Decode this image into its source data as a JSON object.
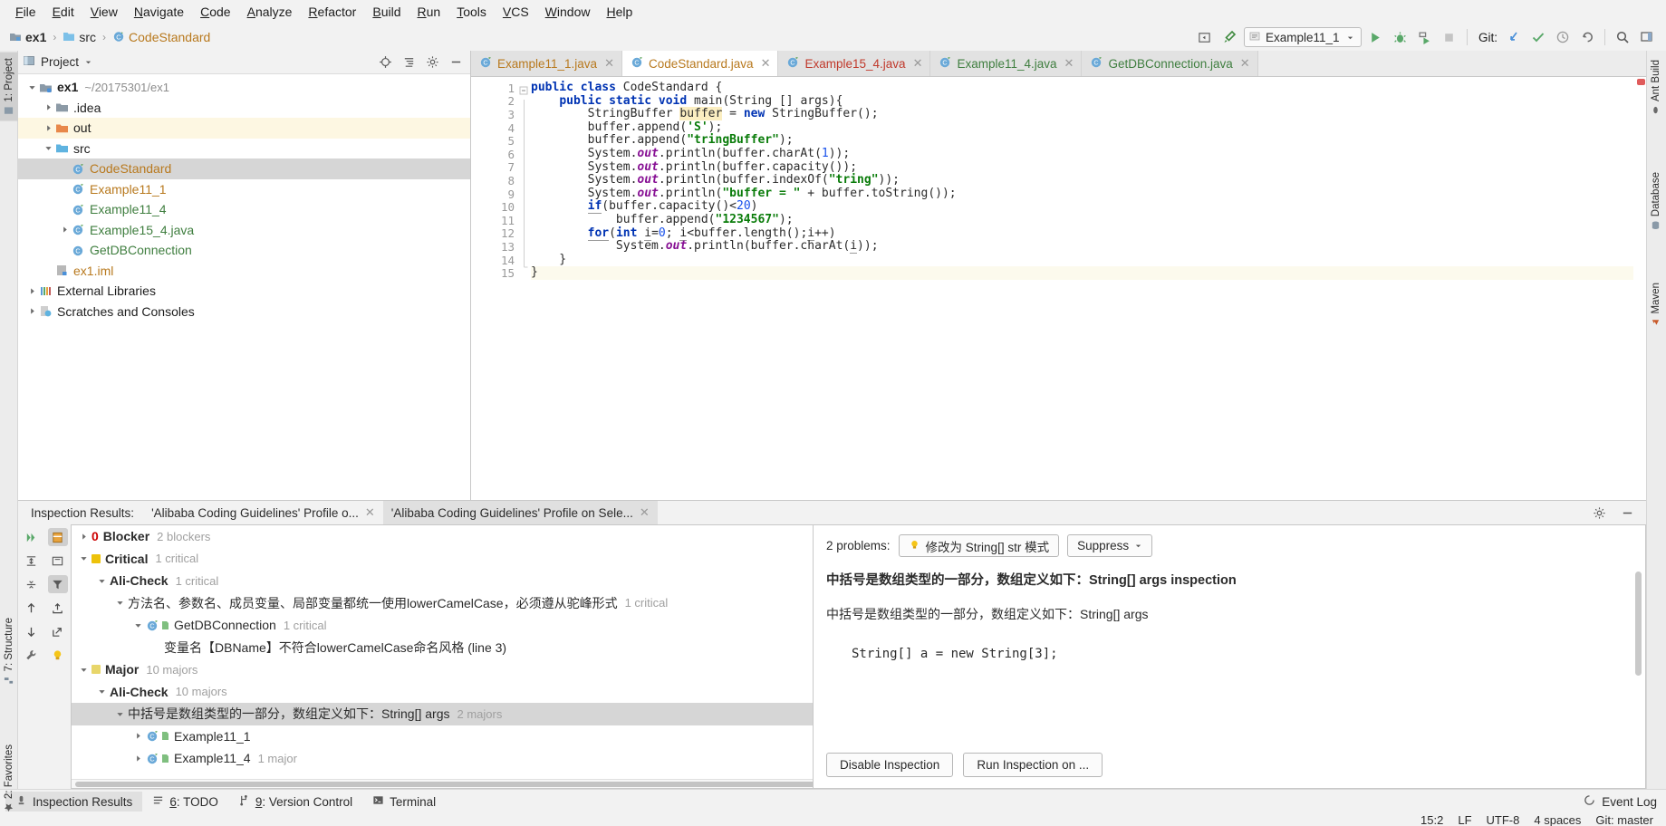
{
  "menubar": {
    "items": [
      "File",
      "Edit",
      "View",
      "Navigate",
      "Code",
      "Analyze",
      "Refactor",
      "Build",
      "Run",
      "Tools",
      "VCS",
      "Window",
      "Help"
    ]
  },
  "navbar": {
    "breadcrumbs": [
      {
        "label": "ex1",
        "icon": "module-icon"
      },
      {
        "label": "src",
        "icon": "folder-icon"
      },
      {
        "label": "CodeStandard",
        "icon": "java-class-icon"
      }
    ],
    "run_config": "Example11_1",
    "git_label": "Git:",
    "icons": [
      "settings-icon",
      "wrench-icon",
      "run-icon",
      "debug-icon",
      "run-coverage-icon",
      "stop-icon",
      "git-update-icon",
      "git-commit-icon",
      "git-history-icon",
      "git-rollback-icon",
      "search-icon",
      "layout-icon"
    ]
  },
  "left_strip": {
    "tabs": [
      {
        "label": "1: Project",
        "selected": true
      },
      {
        "label": "7: Structure",
        "selected": false
      },
      {
        "label": "2: Favorites",
        "selected": false
      }
    ]
  },
  "right_strip": {
    "tabs": [
      "Ant Build",
      "Database",
      "Maven"
    ]
  },
  "project_tree": {
    "title": "Project",
    "header_icons": [
      "locate-icon",
      "collapse-all-icon",
      "settings-icon",
      "hide-icon"
    ],
    "nodes": [
      {
        "label": "ex1",
        "sub": "~/20175301/ex1",
        "indent": 0,
        "arrow": "down",
        "icon": "module-icon",
        "bold": true,
        "color": "dark"
      },
      {
        "label": ".idea",
        "sub": "",
        "indent": 1,
        "arrow": "right",
        "icon": "folder-icon",
        "bold": false,
        "color": "dark"
      },
      {
        "label": "out",
        "sub": "",
        "indent": 1,
        "arrow": "right",
        "icon": "folder-excluded-icon",
        "bold": false,
        "color": "dark",
        "highlight": true
      },
      {
        "label": "src",
        "sub": "",
        "indent": 1,
        "arrow": "down",
        "icon": "source-folder-icon",
        "bold": false,
        "color": "dark"
      },
      {
        "label": "CodeStandard",
        "sub": "",
        "indent": 2,
        "arrow": "none",
        "icon": "java-class-icon",
        "bold": false,
        "color": "orange",
        "selected": true
      },
      {
        "label": "Example11_1",
        "sub": "",
        "indent": 2,
        "arrow": "none",
        "icon": "java-class-icon",
        "bold": false,
        "color": "orange"
      },
      {
        "label": "Example11_4",
        "sub": "",
        "indent": 2,
        "arrow": "none",
        "icon": "java-class-icon",
        "bold": false,
        "color": "green"
      },
      {
        "label": "Example15_4.java",
        "sub": "",
        "indent": 2,
        "arrow": "right",
        "icon": "java-class-icon",
        "bold": false,
        "color": "green"
      },
      {
        "label": "GetDBConnection",
        "sub": "",
        "indent": 2,
        "arrow": "none",
        "icon": "java-class-plain-icon",
        "bold": false,
        "color": "green"
      },
      {
        "label": "ex1.iml",
        "sub": "",
        "indent": 1,
        "arrow": "none",
        "icon": "iml-file-icon",
        "bold": false,
        "color": "orange"
      },
      {
        "label": "External Libraries",
        "sub": "",
        "indent": 0,
        "arrow": "right",
        "icon": "libraries-icon",
        "bold": false,
        "color": "dark"
      },
      {
        "label": "Scratches and Consoles",
        "sub": "",
        "indent": 0,
        "arrow": "right",
        "icon": "scratches-icon",
        "bold": false,
        "color": "dark"
      }
    ]
  },
  "editor": {
    "tabs": [
      {
        "label": "Example11_1.java",
        "color": "orange",
        "active": false
      },
      {
        "label": "CodeStandard.java",
        "color": "orange",
        "active": true
      },
      {
        "label": "Example15_4.java",
        "color": "red",
        "active": false
      },
      {
        "label": "Example11_4.java",
        "color": "green",
        "active": false
      },
      {
        "label": "GetDBConnection.java",
        "color": "green",
        "active": false
      }
    ],
    "line_numbers": [
      "1",
      "2",
      "3",
      "4",
      "5",
      "6",
      "7",
      "8",
      "9",
      "10",
      "11",
      "12",
      "13",
      "14",
      "15"
    ],
    "caret_line": 15,
    "code_lines": [
      "public class CodeStandard {",
      "    public static void main(String [] args){",
      "        StringBuffer buffer = new StringBuffer();",
      "        buffer.append('S');",
      "        buffer.append(\"tringBuffer\");",
      "        System.out.println(buffer.charAt(1));",
      "        System.out.println(buffer.capacity());",
      "        System.out.println(buffer.indexOf(\"tring\"));",
      "        System.out.println(\"buffer = \" + buffer.toString());",
      "        if(buffer.capacity()<20)",
      "            buffer.append(\"1234567\");",
      "        for(int i=0; i<buffer.length();i++)",
      "            System.out.println(buffer.charAt(i));",
      "    }",
      "}"
    ]
  },
  "inspection_panel": {
    "title": "Inspection Results:",
    "tabs": [
      {
        "label": "'Alibaba Coding Guidelines' Profile o...",
        "active": false
      },
      {
        "label": "'Alibaba Coding Guidelines' Profile on Sele...",
        "active": true
      }
    ],
    "header_icons": [
      "settings-icon",
      "hide-icon"
    ],
    "toolbar_left": [
      "rerun-icon",
      "expand-all-icon",
      "collapse-all-icon",
      "prev-icon",
      "next-icon",
      "settings-wrench-icon"
    ],
    "toolbar_right": [
      "group-by-severity-icon",
      "group-by-directory-icon",
      "filter-icon",
      "export-icon",
      "open-icon",
      "quickfix-bulb-icon"
    ],
    "tree": [
      {
        "label": "Blocker",
        "count": "2 blockers",
        "indent": 0,
        "arrow": "right",
        "badge": "blocker",
        "bold": true
      },
      {
        "label": "Critical",
        "count": "1 critical",
        "indent": 0,
        "arrow": "down",
        "badge": "critical",
        "bold": true
      },
      {
        "label": "Ali-Check",
        "count": "1 critical",
        "indent": 1,
        "arrow": "down",
        "badge": "none",
        "bold": true
      },
      {
        "label": "方法名、参数名、成员变量、局部变量都统一使用lowerCamelCase，必须遵从驼峰形式",
        "count": "1 critical",
        "indent": 2,
        "arrow": "down",
        "badge": "none",
        "bold": false
      },
      {
        "label": "GetDBConnection",
        "count": "1 critical",
        "indent": 3,
        "arrow": "down",
        "badge": "class",
        "bold": false
      },
      {
        "label": "变量名【DBName】不符合lowerCamelCase命名风格 (line 3)",
        "count": "",
        "indent": 4,
        "arrow": "none",
        "badge": "none",
        "bold": false
      },
      {
        "label": "Major",
        "count": "10 majors",
        "indent": 0,
        "arrow": "down",
        "badge": "major",
        "bold": true
      },
      {
        "label": "Ali-Check",
        "count": "10 majors",
        "indent": 1,
        "arrow": "down",
        "badge": "none",
        "bold": true
      },
      {
        "label": "中括号是数组类型的一部分，数组定义如下：String[] args",
        "count": "2 majors",
        "indent": 2,
        "arrow": "down",
        "badge": "none",
        "bold": false,
        "selected": true
      },
      {
        "label": "Example11_1",
        "count": "",
        "indent": 3,
        "arrow": "right",
        "badge": "class",
        "bold": false
      },
      {
        "label": "Example11_4",
        "count": "1 major",
        "indent": 3,
        "arrow": "right",
        "badge": "class",
        "bold": false
      }
    ]
  },
  "description": {
    "problems_label": "2 problems:",
    "quickfix_label": "修改为 String[] str 模式",
    "suppress_label": "Suppress",
    "heading": "中括号是数组类型的一部分，数组定义如下：String[] args inspection",
    "body": "中括号是数组类型的一部分，数组定义如下：String[] args",
    "code_sample": "String[] a = new String[3];",
    "buttons": [
      "Disable Inspection",
      "Run Inspection on ..."
    ]
  },
  "statusbar": {
    "tabs": [
      {
        "label": "Inspection Results",
        "icon": "inspection-icon",
        "active": true
      },
      {
        "label": "6: TODO",
        "icon": "todo-icon",
        "active": false,
        "mnemonic": "6"
      },
      {
        "label": "9: Version Control",
        "icon": "vcs-icon",
        "active": false,
        "mnemonic": "9"
      },
      {
        "label": "Terminal",
        "icon": "terminal-icon",
        "active": false
      }
    ],
    "event_log": "Event Log",
    "position": "15:2",
    "line_sep": "LF",
    "encoding": "UTF-8",
    "indent": "4 spaces",
    "branch": "Git: master"
  },
  "colors": {
    "accent_orange": "#b8791e",
    "accent_green": "#3f7e3f",
    "accent_red": "#c0392b",
    "selection": "#d6d6d6",
    "blocker": "#cc0000",
    "critical": "#edc20a",
    "major": "#e8d66a",
    "keyword": "#0033b3",
    "string": "#0a7c0a"
  }
}
